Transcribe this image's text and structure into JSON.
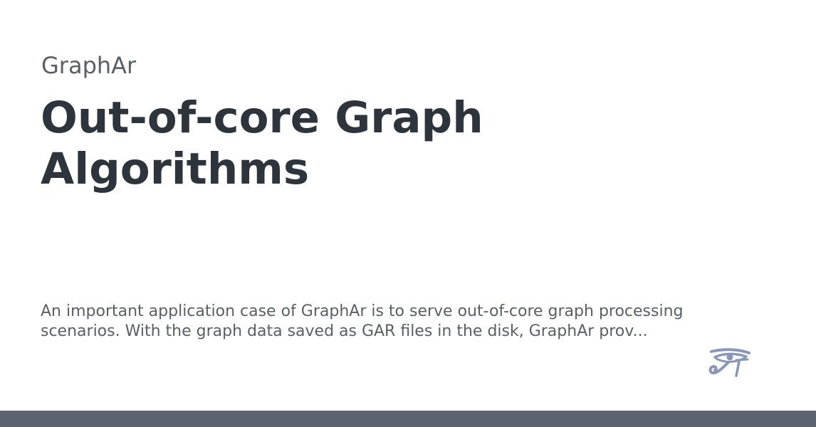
{
  "site": {
    "name": "GraphAr"
  },
  "page": {
    "title": "Out-of-core Graph Algorithms",
    "description": "An important application case of GraphAr is to serve out-of-core graph processing scenarios. With the graph data saved as GAR files in the disk, GraphAr prov..."
  },
  "logo": {
    "icon": "eye-of-horus-icon",
    "color": "#8a96b5"
  },
  "colors": {
    "title": "#2e343b",
    "text": "#5a5f66",
    "bottom_bar": "#5c6370",
    "background": "#ffffff"
  }
}
